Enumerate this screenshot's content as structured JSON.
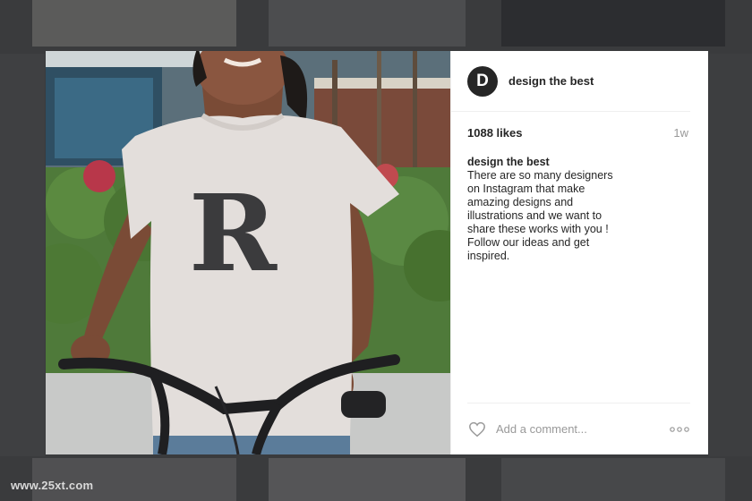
{
  "post": {
    "username": "design the best",
    "avatar_letter": "D",
    "likes": "1088 likes",
    "age": "1w",
    "caption_user": "design the best",
    "caption_text": "There are so many designers on Instagram that make amazing designs and illustrations and we want to share these works with you ! Follow our ideas and get inspired."
  },
  "comment": {
    "placeholder": "Add a comment..."
  },
  "icons": {
    "like": "heart-icon",
    "more": "more-options-icon"
  },
  "image": {
    "shirt_letter": "R"
  },
  "watermark": "www.25xt.com",
  "colors": {
    "text": "#262626",
    "muted": "#999999",
    "divider": "#efefef",
    "backdrop": "#3a3b3d"
  }
}
